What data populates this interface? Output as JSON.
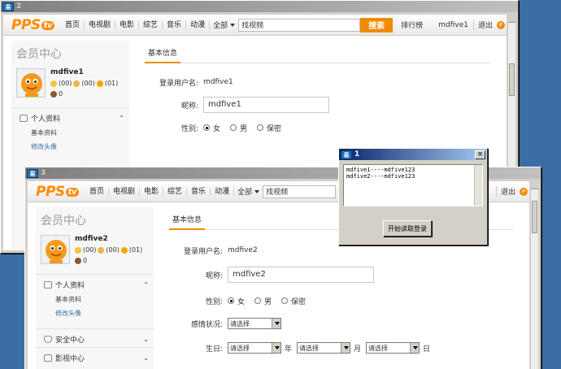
{
  "site": {
    "logo_main": "PPS",
    "logo_tv": "tv",
    "nav": [
      "首页",
      "电视剧",
      "电影",
      "综艺",
      "音乐",
      "动漫"
    ],
    "all_label": "全部",
    "search_placeholder": "找视频",
    "search_button": "搜索",
    "ranking": "排行榜",
    "logout": "退出"
  },
  "back_window": {
    "title": "2",
    "username": "mdfive1",
    "nickname_value": "mdfive1",
    "sidebar_title": "会员中心",
    "stats": [
      "(00)",
      "(00)",
      "(01)"
    ],
    "coins": "0",
    "menu_section": "个人资料",
    "sub_items": [
      "基本资料",
      "修改头像"
    ],
    "tab": "基本信息",
    "login_label": "登录用户名:",
    "nickname_label": "昵称:",
    "gender_label": "性别:",
    "genders": [
      "女",
      "男",
      "保密"
    ]
  },
  "front_window": {
    "title": "3",
    "username": "mdfive2",
    "nickname_value": "mdfive2",
    "sidebar_title": "会员中心",
    "stats": [
      "(00)",
      "(00)",
      "(01)"
    ],
    "coins": "0",
    "menu_section": "个人资料",
    "sub_items": [
      "基本资料",
      "修改头像"
    ],
    "security": "安全中心",
    "video": "影视中心",
    "tab": "基本信息",
    "login_label": "登录用户名:",
    "nickname_label": "昵称:",
    "gender_label": "性别:",
    "genders": [
      "女",
      "男",
      "保密"
    ],
    "emotion_label": "感情状况:",
    "select_placeholder": "请选择",
    "birthday_label": "生日:",
    "year": "年",
    "month": "月",
    "day": "日"
  },
  "dialog": {
    "title": "1",
    "lines": [
      "mdfive1----mdfive123",
      "mdfive2----mdfive123"
    ],
    "button": "开始读取登录"
  },
  "colors": {
    "accent": "#f08a00",
    "titlebar": "#0a246a",
    "desktop": "#3a6ea5"
  }
}
